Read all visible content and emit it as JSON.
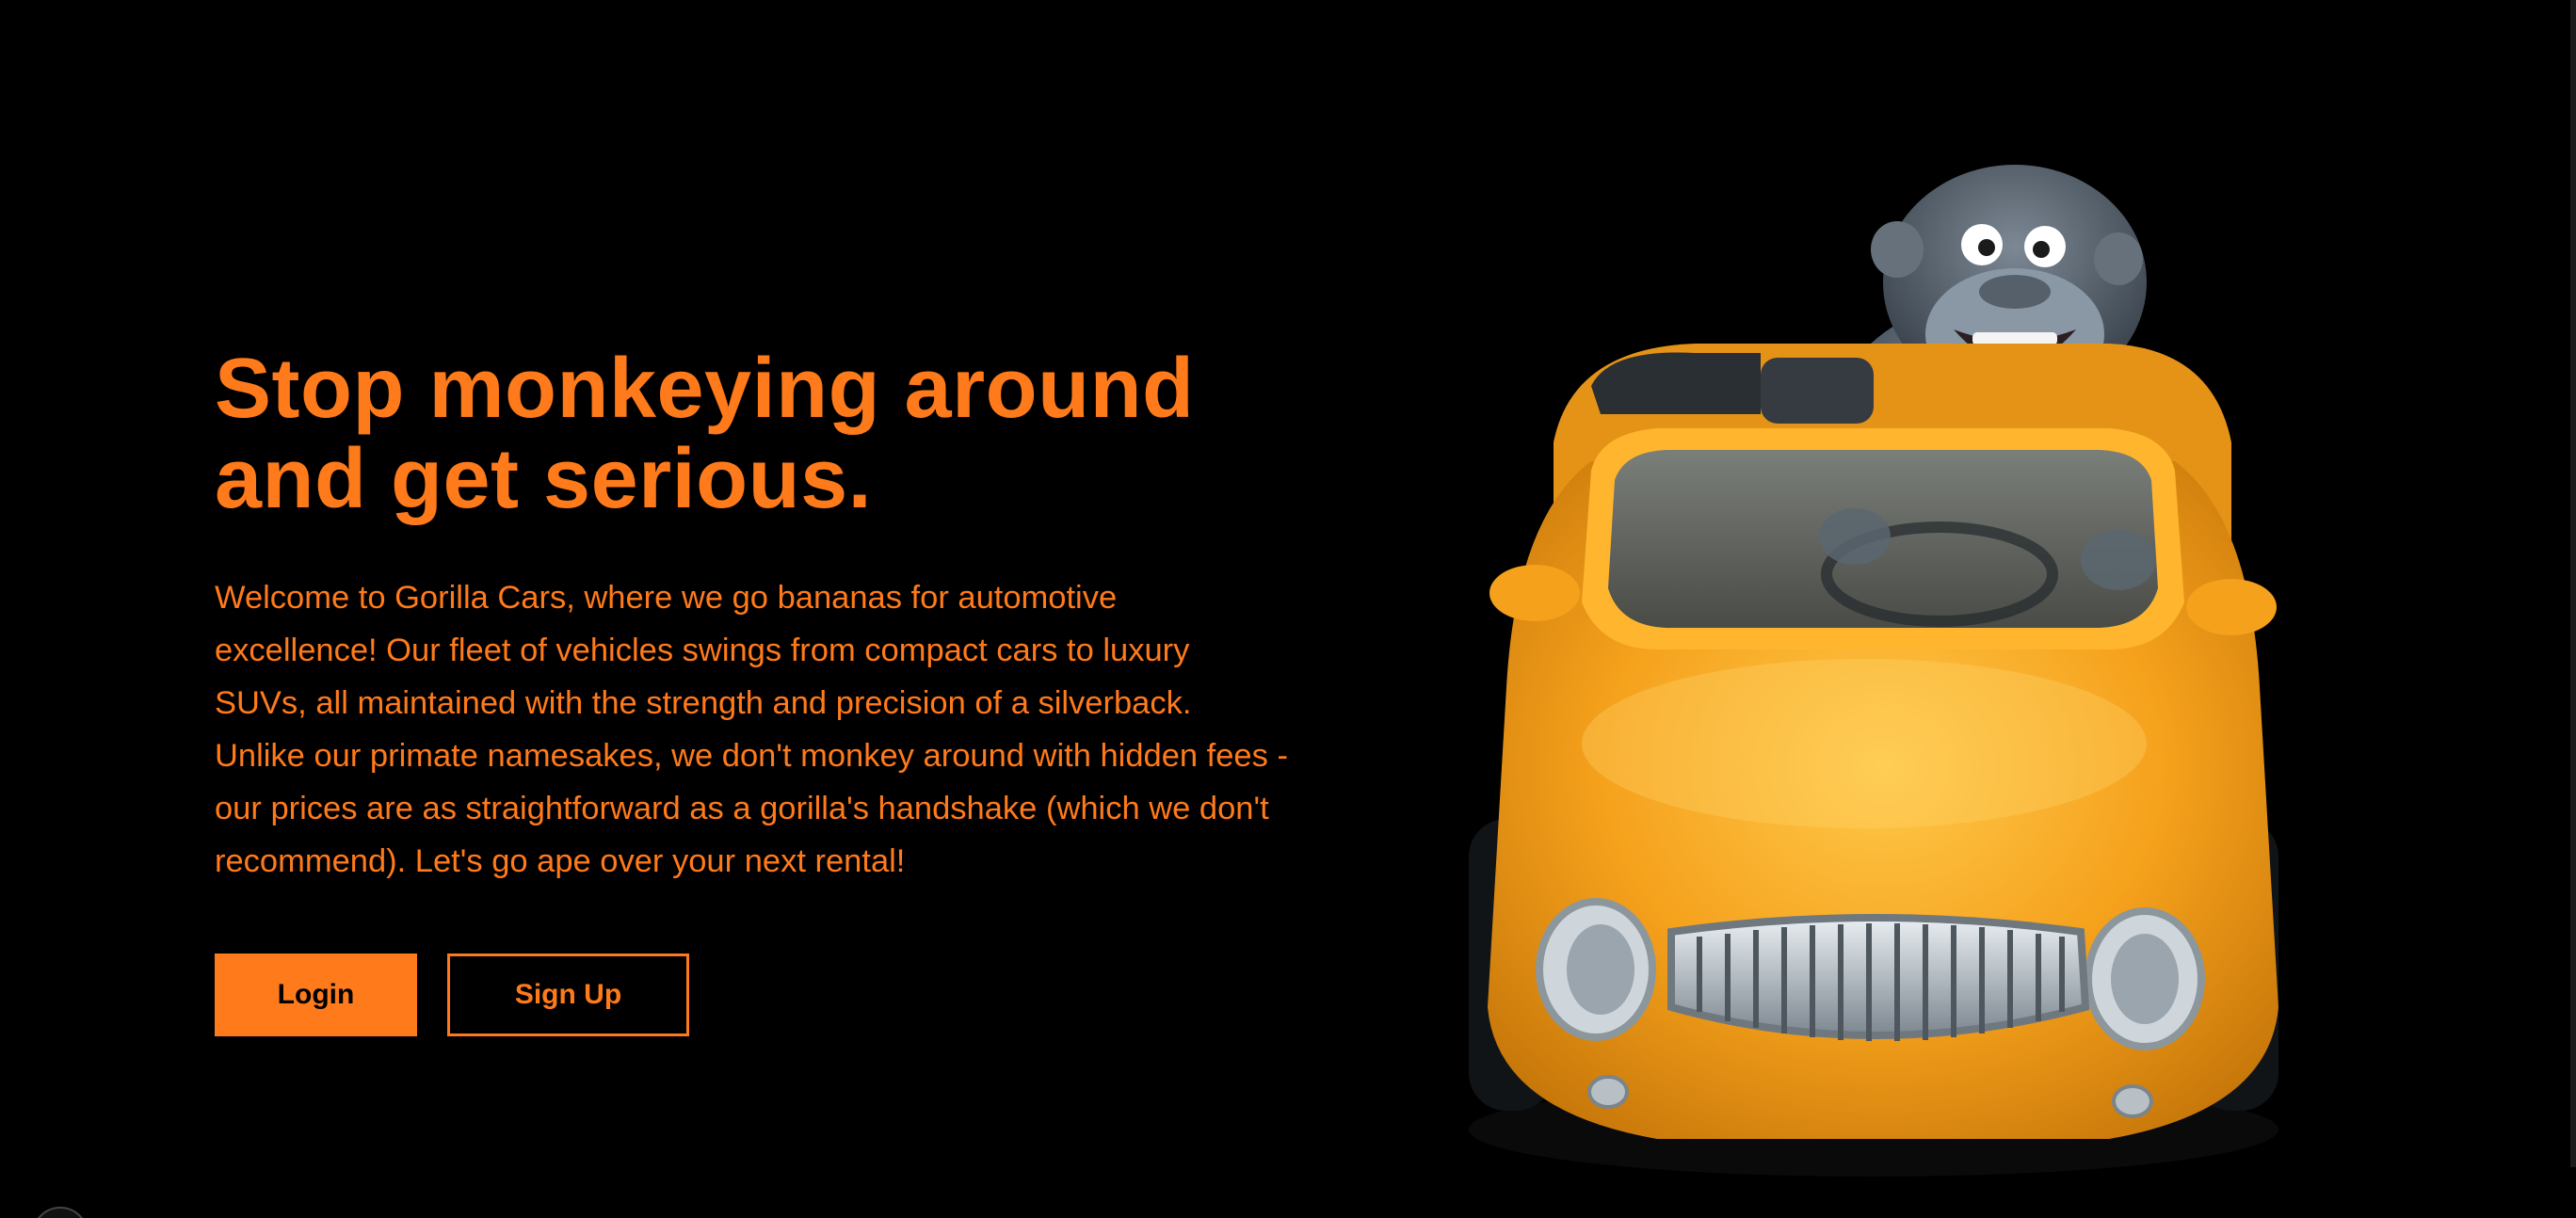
{
  "hero": {
    "headline_line1": "Stop monkeying around",
    "headline_line2": "and get serious.",
    "intro": "Welcome to Gorilla Cars, where we go bananas for automotive excellence! Our fleet of vehicles swings from compact cars to luxury SUVs, all maintained with the strength and precision of a silverback. Unlike our primate namesakes, we don't monkey around with hidden fees - our prices are as straightforward as a gorilla's handshake (which we don't recommend). Let's go ape over your next rental!"
  },
  "actions": {
    "login_label": "Login",
    "signup_label": "Sign Up"
  },
  "image": {
    "description_icon": "gorilla-in-yellow-convertible"
  },
  "colors": {
    "background": "#000000",
    "accent": "#ff7a1a",
    "car_yellow": "#f5a623",
    "gorilla_gray": "#5a6470"
  }
}
